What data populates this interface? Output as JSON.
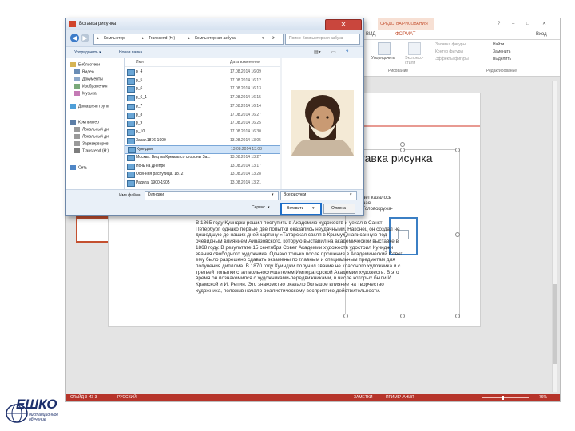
{
  "ppt": {
    "title_buttons": {
      "help": "?",
      "min": "–",
      "max": "□",
      "close": "✕"
    },
    "login": "Вход",
    "contextual_tab": "СРЕДСТВА РИСОВАНИЯ",
    "tabs": {
      "vid": "ВИД",
      "format": "ФОРМАТ"
    },
    "ribbon": {
      "arrange": "Упорядочить",
      "express": "Экспресс-стили",
      "fill": "Заливка фигуры",
      "outline": "Контур фигуры",
      "effects": "Эффекты фигуры",
      "find": "Найти",
      "replace": "Заменить",
      "select": "Выделить",
      "group_drawing": "Рисование",
      "group_editing": "Редактирование"
    },
    "status": {
      "slide": "СЛАЙД 3 ИЗ 3",
      "lang": "РУССКИЙ",
      "notes": "ЗАМЕТКИ",
      "comments": "ПРИМЕЧАНИЯ",
      "zoom": "76%"
    }
  },
  "slide": {
    "title": "Вставка рисунка",
    "partial_lines": [
      "ает казалось",
      "ная",
      "Головокружа-",
      "в."
    ],
    "body": "В 1865 году Куинджи решил поступить в Академию художеств и уехал в Санкт-Петербург, однако первые две попытки оказались неудачными. Наконец он создал не дошедшую до наших дней картину «Татарская сакля в Крыму», написанную под очевидным влиянием Айвазовского, которую выставил на академической выставке в 1868 году. В результате 15 сентября Совет Академии художеств удостоил Куинджи звания свободного художника. Однако только после прошения в Академический Совет ему было разрешено сдавать экзамены по главным и специальным предметам для получения диплома. В 1870 году Куинджи получил звание не классного художника и с третьей попытки стал вольнослушателем Императорской Академии художеств. В это время он познакомился с художниками-передвижниками, в числе которых были И. Крамской и И. Репин. Это знакомство оказало большое влияние на творчество художника, положив начало реалистическому восприятию действительности."
  },
  "dialog": {
    "title": "Вставка рисунка",
    "address": [
      "Компьютер",
      "Transcend (H:)",
      "Компьютерная азбука"
    ],
    "search_placeholder": "Поиск: Компьютерная азбука",
    "organize": "Упорядочить ▾",
    "new_folder": "Новая папка",
    "nav": [
      {
        "label": "Библиотеки",
        "icon": "library-icon",
        "color": "#d6b454"
      },
      {
        "label": "Видео",
        "icon": "video-icon",
        "color": "#6a8db5"
      },
      {
        "label": "Документы",
        "icon": "documents-icon",
        "color": "#8da8c8"
      },
      {
        "label": "Изображения",
        "icon": "images-icon",
        "color": "#7aa97a"
      },
      {
        "label": "Музыка",
        "icon": "music-icon",
        "color": "#c47ab5"
      },
      {
        "label": "Домашняя групп",
        "icon": "homegroup-icon",
        "color": "#4f9fd8"
      },
      {
        "label": "Компьютер",
        "icon": "computer-icon",
        "color": "#5d7ea6"
      },
      {
        "label": "Локальный ди",
        "icon": "drive-icon",
        "color": "#9a9a9a"
      },
      {
        "label": "Локальный ди",
        "icon": "drive-icon",
        "color": "#9a9a9a"
      },
      {
        "label": "Зарезервиров",
        "icon": "drive-icon",
        "color": "#9a9a9a"
      },
      {
        "label": "Transcend (H:)",
        "icon": "usb-drive-icon",
        "color": "#7d7d7d"
      },
      {
        "label": "Сеть",
        "icon": "network-icon",
        "color": "#4f86c6"
      }
    ],
    "col_name": "Имя",
    "col_date": "Дата изменения",
    "files": [
      {
        "name": "p_4",
        "date": "17.08.2014 16:09"
      },
      {
        "name": "p_5",
        "date": "17.08.2014 16:12"
      },
      {
        "name": "p_6",
        "date": "17.08.2014 16:13"
      },
      {
        "name": "p_6_1",
        "date": "17.08.2014 16:15"
      },
      {
        "name": "p_7",
        "date": "17.08.2014 16:14"
      },
      {
        "name": "p_8",
        "date": "17.08.2014 16:27"
      },
      {
        "name": "p_9",
        "date": "17.08.2014 16:25"
      },
      {
        "name": "p_10",
        "date": "17.08.2014 16:30"
      },
      {
        "name": "Закат.1876-1900",
        "date": "13.08.2014 13:05"
      },
      {
        "name": "Куинджи",
        "date": "13.08.2014 13:08"
      },
      {
        "name": "Москва. Вид на Кремль со стороны За...",
        "date": "13.08.2014 13:27"
      },
      {
        "name": "Ночь на Днепре",
        "date": "13.08.2014 13:17"
      },
      {
        "name": "Осенняя распутица. 1872",
        "date": "13.08.2014 13:28"
      },
      {
        "name": "Радуга. 1900-1905",
        "date": "13.08.2014 13:21"
      }
    ],
    "selected_index": 9,
    "filename_label": "Имя файла:",
    "filename_value": "Куинджи",
    "filter_value": "Все рисунки",
    "service": "Сервис",
    "insert": "Вставить",
    "cancel": "Отмена"
  },
  "logo": {
    "name": "ЕШКО",
    "tagline_1": "дистанционное",
    "tagline_2": "обучение"
  }
}
